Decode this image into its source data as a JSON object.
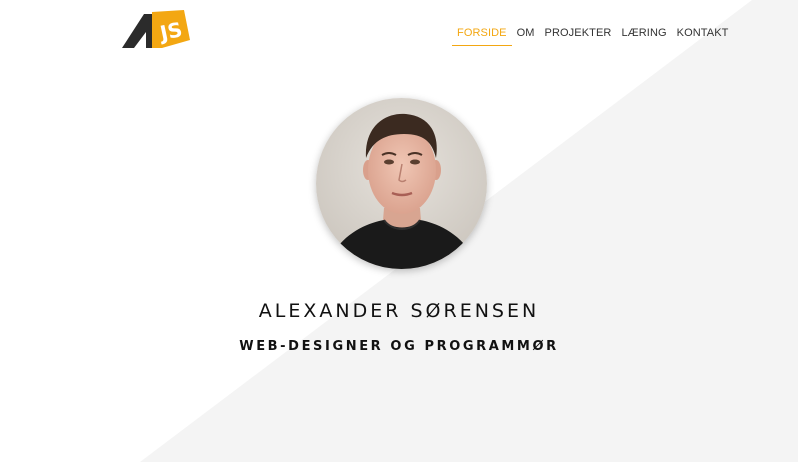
{
  "logo": {
    "name": "AJS logo",
    "accent": "#f3a712",
    "dark": "#2b2b2b"
  },
  "nav": {
    "items": [
      {
        "label": "FORSIDE",
        "active": true
      },
      {
        "label": "OM",
        "active": false
      },
      {
        "label": "PROJEKTER",
        "active": false
      },
      {
        "label": "LÆRING",
        "active": false
      },
      {
        "label": "KONTAKT",
        "active": false
      }
    ]
  },
  "hero": {
    "name": "ALEXANDER SØRENSEN",
    "role": "WEB-DESIGNER OG PROGRAMMØR"
  },
  "colors": {
    "accent": "#f3a712",
    "background_light": "#ffffff",
    "background_shade": "#f4f4f4",
    "text": "#111111"
  }
}
